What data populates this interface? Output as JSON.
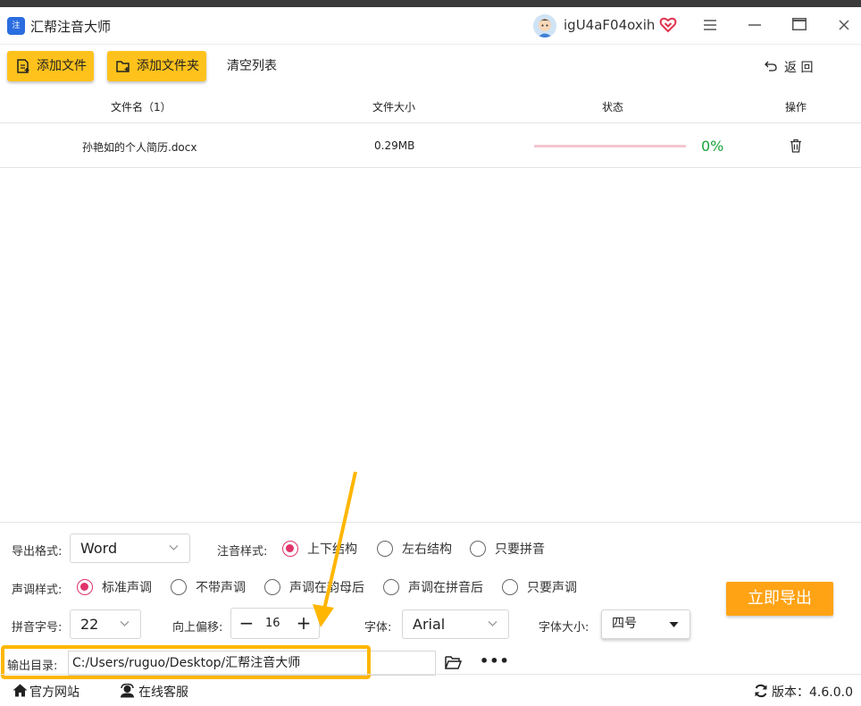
{
  "titlebar": {
    "app_logo_text": "注",
    "title": "汇帮注音大师",
    "username": "igU4aF04oxih"
  },
  "toolbar": {
    "add_file": "添加文件",
    "add_folder": "添加文件夹",
    "clear_list": "清空列表",
    "back": "返 回"
  },
  "table": {
    "headers": {
      "name": "文件名（1）",
      "size": "文件大小",
      "status": "状态",
      "action": "操作"
    },
    "rows": [
      {
        "name": "孙艳如的个人简历.docx",
        "size": "0.29MB",
        "progress": 0,
        "percent": "0%"
      }
    ]
  },
  "settings": {
    "export_format_label": "导出格式:",
    "export_format_value": "Word",
    "annotation_style_label": "注音样式:",
    "annotation_options": [
      "上下结构",
      "左右结构",
      "只要拼音"
    ],
    "tone_style_label": "声调样式:",
    "tone_options": [
      "标准声调",
      "不带声调",
      "声调在韵母后",
      "声调在拼音后",
      "只要声调"
    ],
    "pinyin_size_label": "拼音字号:",
    "pinyin_size_value": "22",
    "offset_label": "向上偏移:",
    "offset_value": "16",
    "font_label": "字体:",
    "font_value": "Arial",
    "font_size_label": "字体大小:",
    "font_size_value": "四号",
    "output_dir_label": "输出目录:",
    "output_dir_value": "C:/Users/ruguo/Desktop/汇帮注音大师",
    "export_button": "立即导出"
  },
  "footer": {
    "website": "官方网站",
    "support": "在线客服",
    "version": "版本：4.6.0.0"
  },
  "colors": {
    "accent_yellow": "#ffc21c",
    "export_orange": "#ffa315",
    "radio_pink": "#e0336a",
    "progress_track": "#f4c7d1",
    "percent_green": "#1aa23a",
    "highlight": "#ffb600"
  }
}
